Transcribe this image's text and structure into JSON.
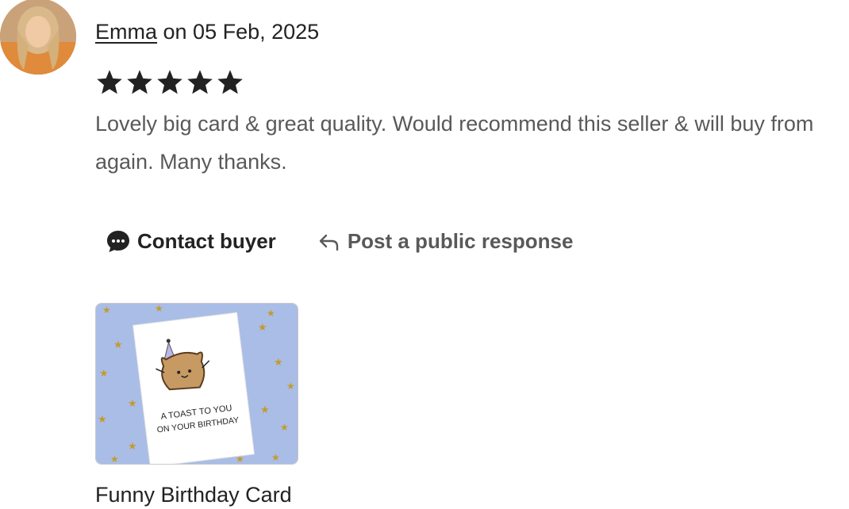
{
  "review": {
    "reviewer_name": "Emma",
    "date_text": " on 05 Feb, 2025",
    "rating": 5,
    "rating_max": 5,
    "text": "Lovely big card & great quality. Would recommend this seller & will buy from again. Many thanks."
  },
  "actions": {
    "contact_label": "Contact buyer",
    "respond_label": "Post a public response"
  },
  "listing": {
    "title": "Funny Birthday Card",
    "card_line1": "A TOAST TO YOU",
    "card_line2": "ON YOUR BIRTHDAY"
  },
  "colors": {
    "star": "#222222",
    "thumb_background": "#a9bde6",
    "card_stars": "#c49a2c"
  }
}
